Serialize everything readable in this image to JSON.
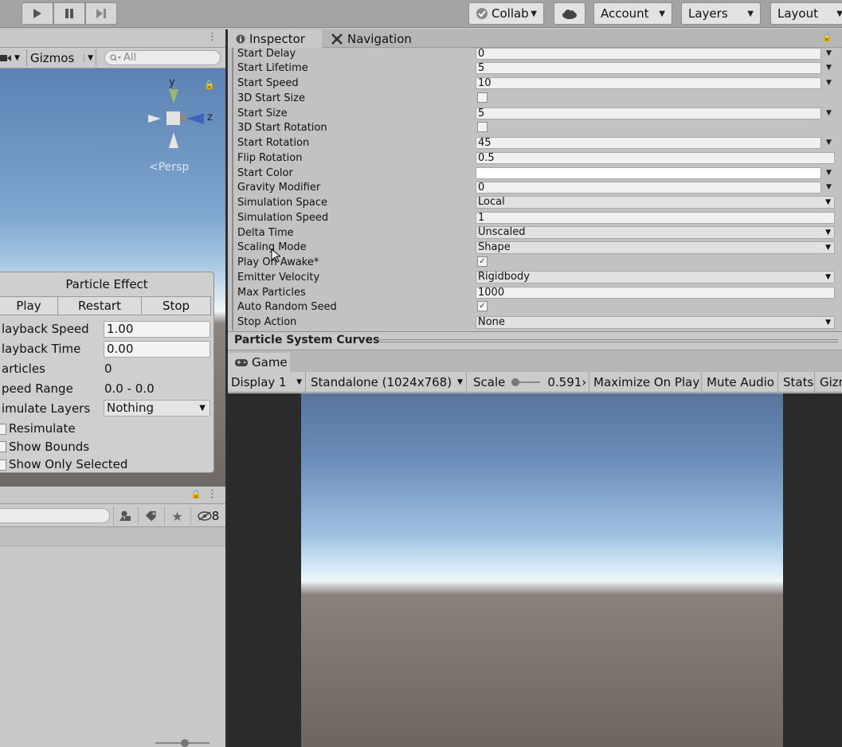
{
  "toolbar": {
    "collab_label": "Collab",
    "account_label": "Account",
    "layers_label": "Layers",
    "layout_label": "Layout"
  },
  "scene": {
    "gizmos_label": "Gizmos",
    "search_placeholder": "All",
    "axis_y": "y",
    "axis_z": "z",
    "persp_label": "Persp"
  },
  "particle_effect": {
    "title": "Particle Effect",
    "play_label": "Play",
    "restart_label": "Restart",
    "stop_label": "Stop",
    "playback_speed_label": "layback Speed",
    "playback_speed_value": "1.00",
    "playback_time_label": "layback Time",
    "playback_time_value": "0.00",
    "particles_label": "articles",
    "particles_value": "0",
    "speed_range_label": "peed Range",
    "speed_range_value": "0.0 - 0.0",
    "simulate_layers_label": "imulate Layers",
    "simulate_layers_value": "Nothing",
    "resimulate_label": "Resimulate",
    "show_bounds_label": "Show Bounds",
    "show_only_selected_label": "Show Only Selected"
  },
  "hierarchy": {
    "hidden_count": "8"
  },
  "inspector": {
    "tab_inspector": "Inspector",
    "tab_navigation": "Navigation",
    "props": {
      "start_delay": {
        "label": "Start Delay",
        "value": "0"
      },
      "start_lifetime": {
        "label": "Start Lifetime",
        "value": "5"
      },
      "start_speed": {
        "label": "Start Speed",
        "value": "10"
      },
      "size_3d": {
        "label": "3D Start Size"
      },
      "start_size": {
        "label": "Start Size",
        "value": "5"
      },
      "rotation_3d": {
        "label": "3D Start Rotation"
      },
      "start_rotation": {
        "label": "Start Rotation",
        "value": "45"
      },
      "flip_rotation": {
        "label": "Flip Rotation",
        "value": "0.5"
      },
      "start_color": {
        "label": "Start Color",
        "value": "#ffffff"
      },
      "gravity_modifier": {
        "label": "Gravity Modifier",
        "value": "0"
      },
      "simulation_space": {
        "label": "Simulation Space",
        "value": "Local"
      },
      "simulation_speed": {
        "label": "Simulation Speed",
        "value": "1"
      },
      "delta_time": {
        "label": "Delta Time",
        "value": "Unscaled"
      },
      "scaling_mode": {
        "label": "Scaling Mode",
        "value": "Shape"
      },
      "play_on_awake": {
        "label": "Play On Awake*",
        "checked": true
      },
      "emitter_velocity": {
        "label": "Emitter Velocity",
        "value": "Rigidbody"
      },
      "max_particles": {
        "label": "Max Particles",
        "value": "1000"
      },
      "auto_random_seed": {
        "label": "Auto Random Seed",
        "checked": true
      },
      "stop_action": {
        "label": "Stop Action",
        "value": "None"
      }
    },
    "curves_title": "Particle System Curves"
  },
  "game": {
    "tab_label": "Game",
    "display_label": "Display 1",
    "resolution_label": "Standalone (1024x768)",
    "scale_label": "Scale",
    "scale_value": "0.591›",
    "maximize_label": "Maximize On Play",
    "mute_label": "Mute Audio",
    "stats_label": "Stats",
    "gizmos_label": "Gizm"
  }
}
